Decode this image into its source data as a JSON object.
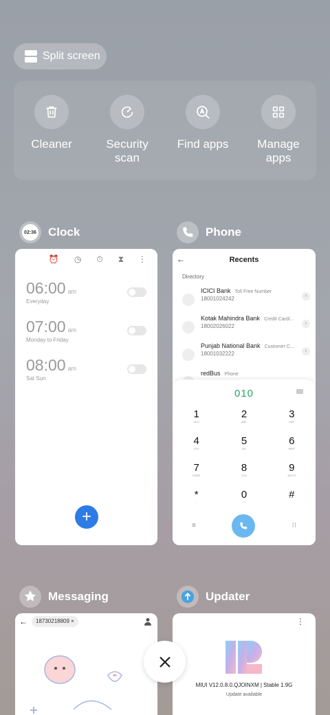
{
  "split_screen": {
    "label": "Split screen"
  },
  "tools": [
    {
      "label": "Cleaner",
      "icon": "trash-icon"
    },
    {
      "label": "Security\nscan",
      "icon": "security-scan-icon"
    },
    {
      "label": "Find apps",
      "icon": "find-apps-icon"
    },
    {
      "label": "Manage\napps",
      "icon": "grid-icon"
    }
  ],
  "clock": {
    "app_name": "Clock",
    "icon_text": "02:36",
    "alarms": [
      {
        "time": "06:00",
        "suffix": "am",
        "repeat": "Everyday"
      },
      {
        "time": "07:00",
        "suffix": "am",
        "repeat": "Monday to Friday"
      },
      {
        "time": "08:00",
        "suffix": "am",
        "repeat": "Sat Sun"
      }
    ]
  },
  "phone": {
    "app_name": "Phone",
    "title": "Recents",
    "directory_label": "Directory",
    "contacts": [
      {
        "name": "ICICI Bank",
        "tag": "Toll Free Number",
        "number": "18001024242"
      },
      {
        "name": "Kotak Mahindra Bank",
        "tag": "Credit Card/...",
        "number": "18002026022"
      },
      {
        "name": "Punjab National Bank",
        "tag": "Customer C...",
        "number": "18001032222"
      },
      {
        "name": "redBus",
        "tag": "Phone",
        "number": ""
      }
    ],
    "dialed": "010",
    "keys": [
      {
        "digit": "1",
        "letters": "GLO"
      },
      {
        "digit": "2",
        "letters": "ABC"
      },
      {
        "digit": "3",
        "letters": "DEF"
      },
      {
        "digit": "4",
        "letters": "GHI"
      },
      {
        "digit": "5",
        "letters": "JKL"
      },
      {
        "digit": "6",
        "letters": "MNO"
      },
      {
        "digit": "7",
        "letters": "PQRS"
      },
      {
        "digit": "8",
        "letters": "TUV"
      },
      {
        "digit": "9",
        "letters": "WXYZ"
      },
      {
        "digit": "*",
        "letters": ","
      },
      {
        "digit": "0",
        "letters": "+"
      },
      {
        "digit": "#",
        "letters": ""
      }
    ]
  },
  "messaging": {
    "app_name": "Messaging",
    "recipient": "18730218809"
  },
  "updater": {
    "app_name": "Updater",
    "version": "MIUI V12.0.8.0.QJOINXM | Stable 1.9G",
    "status": "Update available"
  },
  "colors": {
    "accent_blue": "#2d7be5",
    "dial_green": "#2aa566",
    "call_blue": "#6bb8f0"
  }
}
